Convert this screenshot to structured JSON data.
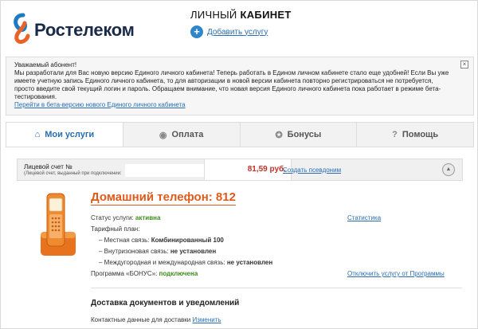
{
  "header": {
    "brand": "Ростелеком",
    "title_part1": "ЛИЧНЫЙ ",
    "title_part2": "КАБИНЕТ",
    "add_service_label": "Добавить услугу"
  },
  "notice": {
    "greeting": "Уважаемый абонент!",
    "body": "Мы разработали для Вас новую версию Единого личного кабинета! Теперь работать в Едином личном кабинете стало еще удобней! Если Вы уже имеете учетную запись Единого личного кабинета, то для авторизации в новой версии кабинета повторно регистрироваться не потребуется, просто введите свой текущий логин и пароль. Обращаем внимание, что новая версия Единого личного кабинета пока работает в режиме бета-тестирования.",
    "link": "Перейти в бета-версию нового Единого личного кабинета",
    "close_icon": "×"
  },
  "tabs": [
    {
      "label": "Мои услуги",
      "icon": "⌂",
      "active": true
    },
    {
      "label": "Оплата",
      "icon": "◉",
      "active": false
    },
    {
      "label": "Бонусы",
      "icon": "✪",
      "active": false
    },
    {
      "label": "Помощь",
      "icon": "?",
      "active": false
    }
  ],
  "account": {
    "label": "Лицевой счет №",
    "sublabel": "(Лицевой счет, выданный при подключении:",
    "balance": "81,59 руб.",
    "alias_link": "Создать псевдоним",
    "collapse_icon": "▲"
  },
  "service": {
    "title": "Домашний телефон: 812",
    "status_label": "Статус услуги: ",
    "status_value": "активна",
    "stats_link": "Статистика",
    "tariff_label": "Тарифный план:",
    "tariff_items": [
      {
        "label": "– Местная связь: ",
        "value": "Комбинированный 100"
      },
      {
        "label": "– Внутризоновая связь: ",
        "value": "не установлен"
      },
      {
        "label": "– Междугородная и международная связь: ",
        "value": "не установлен"
      }
    ],
    "bonus_label": "Программа «БОНУС»: ",
    "bonus_value": "подключена",
    "disconnect_link": "Отключить услугу от Программы"
  },
  "delivery": {
    "title": "Доставка документов и уведомлений",
    "contacts_label": "Контактные данные для доставки ",
    "change_link": "Изменить"
  },
  "colors": {
    "accent": "#2a6db0",
    "title_orange": "#e05a1c",
    "balance_red": "#c0322b",
    "status_green": "#3d8a1e"
  }
}
